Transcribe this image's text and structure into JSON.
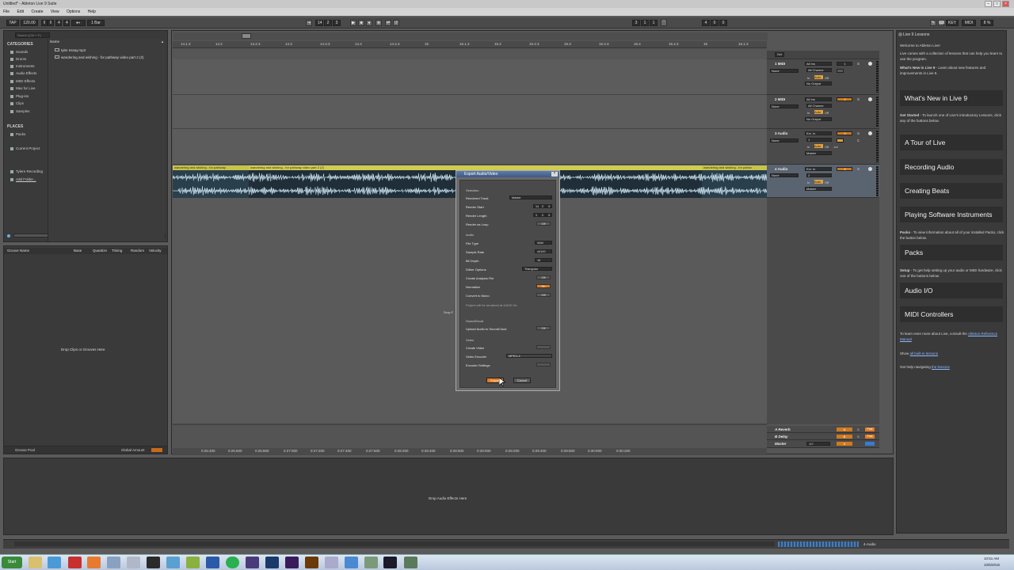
{
  "window": {
    "title": "Untitled* - Ableton Live 9 Suite"
  },
  "menu": [
    "File",
    "Edit",
    "Create",
    "View",
    "Options",
    "Help"
  ],
  "transport": {
    "tap": "TAP",
    "tempo": "120.00",
    "sig_num": "4",
    "sig_den": "4",
    "quant": "1 Bar",
    "pos": [
      "14",
      "2",
      "3"
    ],
    "loop_start": [
      "3",
      "1",
      "1"
    ],
    "loop_len": [
      "4",
      "0",
      "0"
    ],
    "key": "KEY",
    "midi": "MIDI",
    "cpu": "8 %"
  },
  "browser": {
    "search": "Search (Ctrl + F)",
    "categories_label": "CATEGORIES",
    "categories": [
      "Sounds",
      "Drums",
      "Instruments",
      "Audio Effects",
      "MIDI Effects",
      "Max for Live",
      "Plug-ins",
      "Clips",
      "Samples"
    ],
    "places_label": "PLACES",
    "places": [
      "Packs",
      "",
      "Current Project",
      "",
      "",
      "Tylere Recording",
      "Add Folder..."
    ],
    "name_header": "Name",
    "files": [
      "tyler essay.mp3",
      "wandering and wishing - for pathway video part 2 (2)"
    ]
  },
  "groove": {
    "headers": [
      "Groove Name",
      "Base",
      "Quantize",
      "Timing",
      "Random",
      "Velocity"
    ],
    "drop": "Drop Clips or Grooves Here",
    "footer": "Groove Pool",
    "global": "Global Amount"
  },
  "ruler": [
    "14.1.3",
    "14.2",
    "14.2.3",
    "14.3",
    "14.3.3",
    "14.4",
    "14.4.3",
    "15",
    "15.1.3",
    "15.2",
    "15.2.3",
    "15.3",
    "15.3.3",
    "15.4",
    "15.4.3",
    "16",
    "16.1.3"
  ],
  "time_ruler": [
    "0:25:400",
    "0:25:600",
    "0:25:800",
    "0:27:000",
    "0:27:200",
    "0:27:400",
    "0:27:600",
    "0:28:200",
    "0:28:400",
    "0:28:600",
    "0:29:000",
    "0:29:200",
    "0:29:400",
    "0:29:600",
    "0:30:000",
    "0:30:200"
  ],
  "tracks": [
    {
      "name": "1 MIDI",
      "input": "All Ins",
      "chan": "All Channe",
      "none": "None",
      "out": "No Output",
      "num": "1",
      "type": "midi"
    },
    {
      "name": "2 MIDI",
      "input": "All Ins",
      "chan": "All Channe",
      "none": "None",
      "out": "No Output",
      "num": "2",
      "type": "midi"
    },
    {
      "name": "3 Audio",
      "input": "Ext. In",
      "chan": "1",
      "none": "None",
      "out": "Master",
      "num": "3",
      "type": "audio"
    },
    {
      "name": "4 Audio",
      "input": "Ext. In",
      "chan": "2",
      "none": "None",
      "out": "Master",
      "num": "4",
      "type": "audio"
    }
  ],
  "returns": [
    {
      "name": "A Reverb",
      "letter": "A"
    },
    {
      "name": "B Delay",
      "letter": "B"
    },
    {
      "name": "Master",
      "letter": "0"
    }
  ],
  "monitor": {
    "in": "In",
    "auto": "Auto",
    "off": "Off",
    "inf": "-inf",
    "zero": "0",
    "c": "C",
    "post": "Post",
    "solo": "S",
    "half": "1/2"
  },
  "clip": {
    "label": "wandering and wishing - for pathway video part 2 (2)",
    "label_short": "wandering and wishing - for pathway",
    "right_label": "wandering and wishing - for pathw"
  },
  "drop_files": "Drop F",
  "dialog": {
    "title": "Export Audio/Video",
    "selection": "Selection",
    "rendered_track": "Rendered Track",
    "rendered_track_val": "Master",
    "render_start": "Render Start",
    "render_start_val": [
      "14",
      "2",
      "3"
    ],
    "render_length": "Render Length",
    "render_length_val": [
      "1",
      "2",
      "3"
    ],
    "render_loop": "Render as Loop",
    "render_loop_val": "Off",
    "audio": "Audio",
    "file_type": "File Type",
    "file_type_val": "WAV",
    "sample_rate": "Sample Rate",
    "sample_rate_val": "44100",
    "bit_depth": "Bit Depth",
    "bit_depth_val": "16",
    "dither": "Dither Options",
    "dither_val": "Triangular",
    "analysis": "Create Analysis File",
    "analysis_val": "Off",
    "normalize": "Normalize",
    "normalize_val": "On",
    "mono": "Convert to Mono",
    "mono_val": "Off",
    "note": "Project will be rendered at 44100 Hz",
    "soundcloud": "SoundCloud",
    "upload": "Upload Audio to SoundCloud",
    "upload_val": "Off",
    "video": "Video",
    "create_video": "Create Video",
    "create_video_val": "",
    "encoder": "Video Encoder",
    "encoder_val": "MPEG-4",
    "encoder_settings": "Encoder Settings",
    "encoder_settings_val": "",
    "export": "Export",
    "cancel": "Cancel"
  },
  "help": {
    "header": "Live 9 Lessons",
    "welcome": "Welcome to Ableton Live!",
    "intro": "Live comes with a collection of lessons that can help you learn to use the program.",
    "new_lead": "What's New in Live 9",
    "new_text": " - Learn about new features and improvements in Live 9.",
    "btn_new": "What's New in Live 9",
    "started_lead": "Get Started",
    "started_text": " - To launch one of Live's introductory Lessons, click any of the buttons below.",
    "btn_tour": "A Tour of Live",
    "btn_rec": "Recording Audio",
    "btn_beats": "Creating Beats",
    "btn_soft": "Playing Software Instruments",
    "packs_lead": "Packs",
    "packs_text": " - To view information about all of your installed Packs, click the button below.",
    "btn_packs": "Packs",
    "setup_lead": "Setup",
    "setup_text": " - To get help setting up your audio or MIDI hardware, click one of the buttons below.",
    "btn_io": "Audio I/O",
    "btn_midi": "MIDI Controllers",
    "learn_text": "To learn even more about Live, consult the ",
    "manual": "Ableton Reference Manual",
    "show": "Show ",
    "all_lessons": "all built-in lessons",
    "nav_text": "Get help navigating ",
    "lessons": "the lessons"
  },
  "detail": {
    "drop": "Drop Audio Effects Here"
  },
  "status": {
    "track": "4-Audio"
  },
  "taskbar": {
    "start": "Start",
    "time": "10:51 AM",
    "date": "10/5/2016"
  }
}
